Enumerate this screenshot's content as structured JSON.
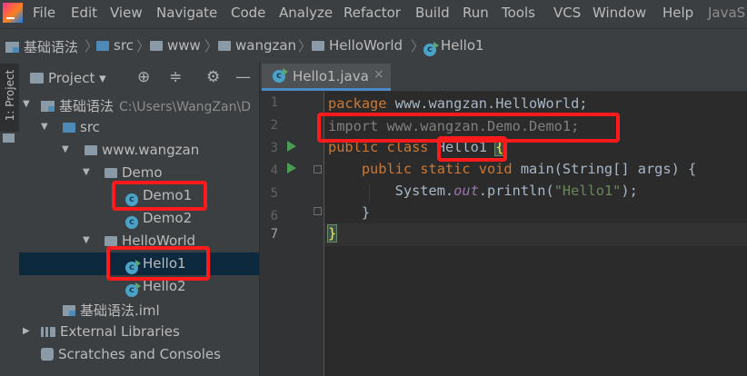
{
  "menu": {
    "items": [
      "File",
      "Edit",
      "View",
      "Navigate",
      "Code",
      "Analyze",
      "Refactor",
      "Build",
      "Run",
      "Tools",
      "VCS",
      "Window",
      "Help"
    ],
    "overflow_label": "JavaS"
  },
  "breadcrumb": {
    "items": [
      "基础语法",
      "src",
      "www",
      "wangzan",
      "HelloWorld",
      "Hello1"
    ]
  },
  "left_strip": {
    "project_tab_label": "1: Project"
  },
  "project_panel": {
    "title": "Project",
    "dropdown_glyph": "▾",
    "tools": {
      "locate_icon": "⊕",
      "collapse_icon": "≑",
      "settings_icon": "⚙",
      "hide_icon": "—"
    },
    "tree": [
      {
        "label": "基础语法",
        "path": "C:\\Users\\WangZan\\D",
        "kind": "module",
        "expanded": true
      },
      {
        "label": "src",
        "kind": "source-folder",
        "expanded": true
      },
      {
        "label": "www.wangzan",
        "kind": "package",
        "expanded": true
      },
      {
        "label": "Demo",
        "kind": "package",
        "expanded": true
      },
      {
        "label": "Demo1",
        "kind": "class",
        "highlighted": true
      },
      {
        "label": "Demo2",
        "kind": "class"
      },
      {
        "label": "HelloWorld",
        "kind": "package",
        "expanded": true
      },
      {
        "label": "Hello1",
        "kind": "class-runnable",
        "selected": true,
        "highlighted": true
      },
      {
        "label": "Hello2",
        "kind": "class-runnable"
      },
      {
        "label": "基础语法.iml",
        "kind": "iml-file"
      },
      {
        "label": "External Libraries",
        "kind": "libraries",
        "expanded": false
      },
      {
        "label": "Scratches and Consoles",
        "kind": "scratches"
      }
    ]
  },
  "editor": {
    "tab": {
      "label": "Hello1.java",
      "close_glyph": "×"
    },
    "line_numbers": [
      "1",
      "2",
      "3",
      "4",
      "5",
      "6",
      "7"
    ],
    "code": {
      "l1_kw": "package",
      "l1_rest": " www.wangzan.HelloWorld;",
      "l2": "import www.wangzan.Demo.Demo1;",
      "l3_kw": "public class",
      "l3_class": "Hello1",
      "l3_brace": "{",
      "l4_indent": "    ",
      "l4_kw": "public static void",
      "l4_rest": " main(String[] args) {",
      "l5_pre": "        System.",
      "l5_out": "out",
      "l5_mid": ".println(",
      "l5_str": "\"Hello1\"",
      "l5_end": ");",
      "l6": "    }",
      "l7": "}"
    }
  },
  "colors": {
    "highlight_border": "#ff1b1b",
    "keyword": "#cc7832",
    "string": "#6a8759",
    "selection": "#0d293e"
  }
}
